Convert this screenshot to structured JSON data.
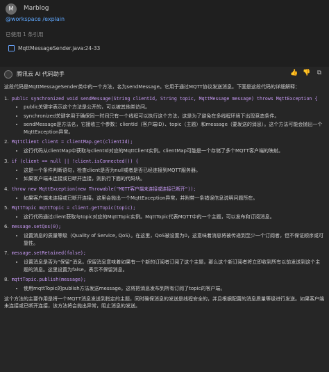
{
  "user": {
    "avatar_letter": "M",
    "name": "Marblog"
  },
  "mention": "@workspace /explain",
  "refs_label": "已使用 1 条引用",
  "file_ref": "MqttMessageSender.java:24-33",
  "assistant": {
    "name": "腾讯云 AI 代码助手"
  },
  "intro": "这段代码是MqttMessageSender类中的一个方法，名为sendMessage。它用于通过MQTT协议发送消息。下面是这段代码的详细解释：",
  "steps": [
    {
      "num": "1.",
      "code": "public synchronized void sendMessage(String clientId, String topic, MqttMessage message) throws MqttException {",
      "bullets": [
        "public关键字表示这个方法是公开的，可以被其他类访问。",
        "synchronized关键字用于确保同一时间只有一个线程可以执行这个方法，这是为了避免在多线程环境下出现竞态条件。",
        "sendMessage是方法名，它接收三个参数：clientId（客户端ID）、topic（主题）和message（要发送的消息）。这个方法可能会抛出一个MqttException异常。"
      ]
    },
    {
      "num": "2.",
      "code": "MqttClient client = clientMap.get(clientId);",
      "bullets": [
        "这行代码从clientMap中获取与clientId对应的MqttClient实例。clientMap可能是一个存储了多个MQTT客户端的映射。"
      ]
    },
    {
      "num": "3.",
      "code": "if (client == null || !client.isConnected()) {",
      "bullets": [
        "这是一个条件判断语句，检查client是否为null或者是否已经连接到MQTT服务器。",
        "如果客户端未连接或已断开连接，则执行下面的代码块。"
      ]
    },
    {
      "num": "4.",
      "code": "throw new MqttException(new Throwable(\"MQTT客户端未连接或连接已断开\"));",
      "bullets": [
        "如果客户端未连接或已断开连接，这里会抛出一个MqttException异常，并附带一条错误信息说明问题所在。"
      ]
    },
    {
      "num": "5.",
      "code": "MqttTopic mqttTopic = client.getTopic(topic);",
      "bullets": [
        "这行代码通过client获取与topic对应的MqttTopic实例。MqttTopic代表MQTT中的一个主题，可以发布和订阅消息。"
      ]
    },
    {
      "num": "6.",
      "code": "message.setQos(0);",
      "bullets": [
        "设置消息的质量等级（Quality of Service, QoS）。在这里，QoS被设置为0，这意味着消息将被传递到至少一个订阅者，但不保证顺序或可靠性。"
      ]
    },
    {
      "num": "7.",
      "code": "message.setRetained(false);",
      "bullets": [
        "设置消息是否为“保留”消息。保留消息意味着如果有一个新的订阅者订阅了这个主题，那么这个新订阅者将立即收到所有以前发送到这个主题的消息。这里设置为false，表示不保留消息。"
      ]
    },
    {
      "num": "8.",
      "code": "mqttTopic.publish(message);",
      "bullets": [
        "使用mqttTopic的publish方法发送message。这将把消息发布到所有订阅了topic的客户端。"
      ]
    }
  ],
  "summary": "这个方法的主要作用是将一个MQTT消息发送到指定的主题，同时确保消息的发送是线程安全的，并且根据配置的消息质量等级进行发送。如果客户端未连接或已断开连接，该方法将会抛出异常，阻止消息的发送。",
  "icons": {
    "like": "thumb-up-icon",
    "dislike": "thumb-down-icon",
    "copy": "copy-icon"
  }
}
